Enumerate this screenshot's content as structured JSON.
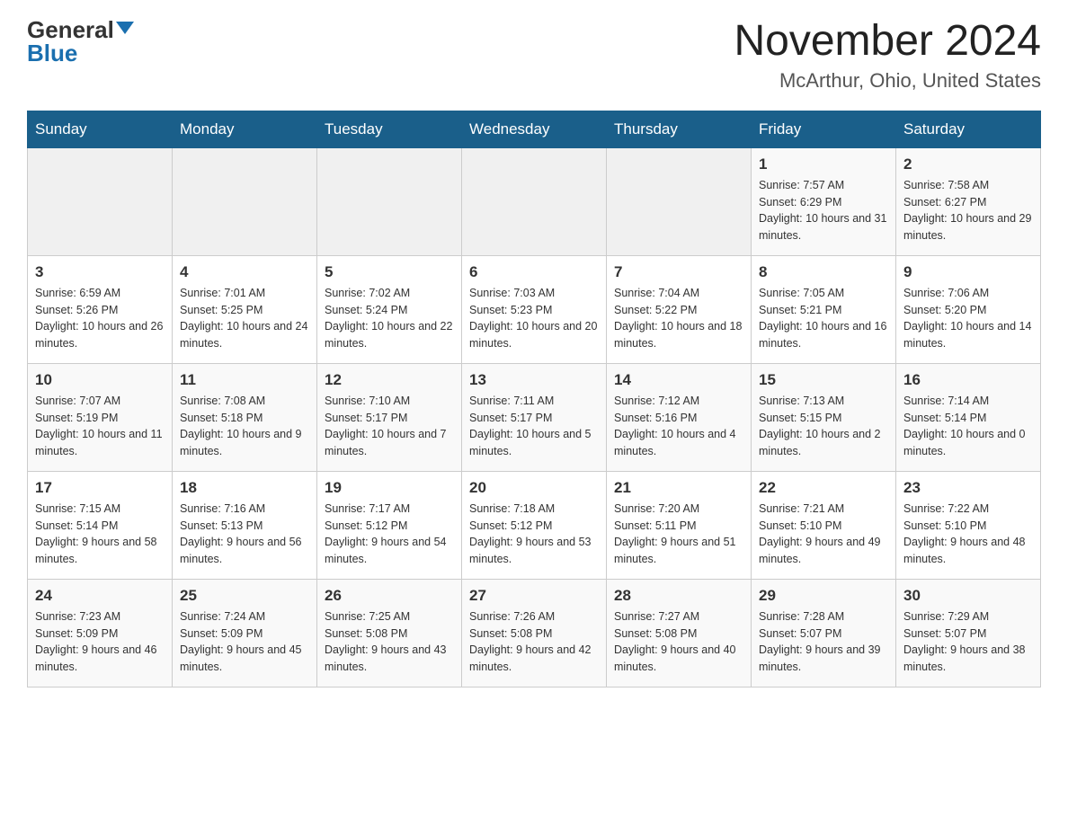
{
  "logo": {
    "general": "General",
    "blue": "Blue"
  },
  "title": "November 2024",
  "subtitle": "McArthur, Ohio, United States",
  "days_of_week": [
    "Sunday",
    "Monday",
    "Tuesday",
    "Wednesday",
    "Thursday",
    "Friday",
    "Saturday"
  ],
  "weeks": [
    [
      {
        "day": "",
        "info": ""
      },
      {
        "day": "",
        "info": ""
      },
      {
        "day": "",
        "info": ""
      },
      {
        "day": "",
        "info": ""
      },
      {
        "day": "",
        "info": ""
      },
      {
        "day": "1",
        "info": "Sunrise: 7:57 AM\nSunset: 6:29 PM\nDaylight: 10 hours and 31 minutes."
      },
      {
        "day": "2",
        "info": "Sunrise: 7:58 AM\nSunset: 6:27 PM\nDaylight: 10 hours and 29 minutes."
      }
    ],
    [
      {
        "day": "3",
        "info": "Sunrise: 6:59 AM\nSunset: 5:26 PM\nDaylight: 10 hours and 26 minutes."
      },
      {
        "day": "4",
        "info": "Sunrise: 7:01 AM\nSunset: 5:25 PM\nDaylight: 10 hours and 24 minutes."
      },
      {
        "day": "5",
        "info": "Sunrise: 7:02 AM\nSunset: 5:24 PM\nDaylight: 10 hours and 22 minutes."
      },
      {
        "day": "6",
        "info": "Sunrise: 7:03 AM\nSunset: 5:23 PM\nDaylight: 10 hours and 20 minutes."
      },
      {
        "day": "7",
        "info": "Sunrise: 7:04 AM\nSunset: 5:22 PM\nDaylight: 10 hours and 18 minutes."
      },
      {
        "day": "8",
        "info": "Sunrise: 7:05 AM\nSunset: 5:21 PM\nDaylight: 10 hours and 16 minutes."
      },
      {
        "day": "9",
        "info": "Sunrise: 7:06 AM\nSunset: 5:20 PM\nDaylight: 10 hours and 14 minutes."
      }
    ],
    [
      {
        "day": "10",
        "info": "Sunrise: 7:07 AM\nSunset: 5:19 PM\nDaylight: 10 hours and 11 minutes."
      },
      {
        "day": "11",
        "info": "Sunrise: 7:08 AM\nSunset: 5:18 PM\nDaylight: 10 hours and 9 minutes."
      },
      {
        "day": "12",
        "info": "Sunrise: 7:10 AM\nSunset: 5:17 PM\nDaylight: 10 hours and 7 minutes."
      },
      {
        "day": "13",
        "info": "Sunrise: 7:11 AM\nSunset: 5:17 PM\nDaylight: 10 hours and 5 minutes."
      },
      {
        "day": "14",
        "info": "Sunrise: 7:12 AM\nSunset: 5:16 PM\nDaylight: 10 hours and 4 minutes."
      },
      {
        "day": "15",
        "info": "Sunrise: 7:13 AM\nSunset: 5:15 PM\nDaylight: 10 hours and 2 minutes."
      },
      {
        "day": "16",
        "info": "Sunrise: 7:14 AM\nSunset: 5:14 PM\nDaylight: 10 hours and 0 minutes."
      }
    ],
    [
      {
        "day": "17",
        "info": "Sunrise: 7:15 AM\nSunset: 5:14 PM\nDaylight: 9 hours and 58 minutes."
      },
      {
        "day": "18",
        "info": "Sunrise: 7:16 AM\nSunset: 5:13 PM\nDaylight: 9 hours and 56 minutes."
      },
      {
        "day": "19",
        "info": "Sunrise: 7:17 AM\nSunset: 5:12 PM\nDaylight: 9 hours and 54 minutes."
      },
      {
        "day": "20",
        "info": "Sunrise: 7:18 AM\nSunset: 5:12 PM\nDaylight: 9 hours and 53 minutes."
      },
      {
        "day": "21",
        "info": "Sunrise: 7:20 AM\nSunset: 5:11 PM\nDaylight: 9 hours and 51 minutes."
      },
      {
        "day": "22",
        "info": "Sunrise: 7:21 AM\nSunset: 5:10 PM\nDaylight: 9 hours and 49 minutes."
      },
      {
        "day": "23",
        "info": "Sunrise: 7:22 AM\nSunset: 5:10 PM\nDaylight: 9 hours and 48 minutes."
      }
    ],
    [
      {
        "day": "24",
        "info": "Sunrise: 7:23 AM\nSunset: 5:09 PM\nDaylight: 9 hours and 46 minutes."
      },
      {
        "day": "25",
        "info": "Sunrise: 7:24 AM\nSunset: 5:09 PM\nDaylight: 9 hours and 45 minutes."
      },
      {
        "day": "26",
        "info": "Sunrise: 7:25 AM\nSunset: 5:08 PM\nDaylight: 9 hours and 43 minutes."
      },
      {
        "day": "27",
        "info": "Sunrise: 7:26 AM\nSunset: 5:08 PM\nDaylight: 9 hours and 42 minutes."
      },
      {
        "day": "28",
        "info": "Sunrise: 7:27 AM\nSunset: 5:08 PM\nDaylight: 9 hours and 40 minutes."
      },
      {
        "day": "29",
        "info": "Sunrise: 7:28 AM\nSunset: 5:07 PM\nDaylight: 9 hours and 39 minutes."
      },
      {
        "day": "30",
        "info": "Sunrise: 7:29 AM\nSunset: 5:07 PM\nDaylight: 9 hours and 38 minutes."
      }
    ]
  ]
}
